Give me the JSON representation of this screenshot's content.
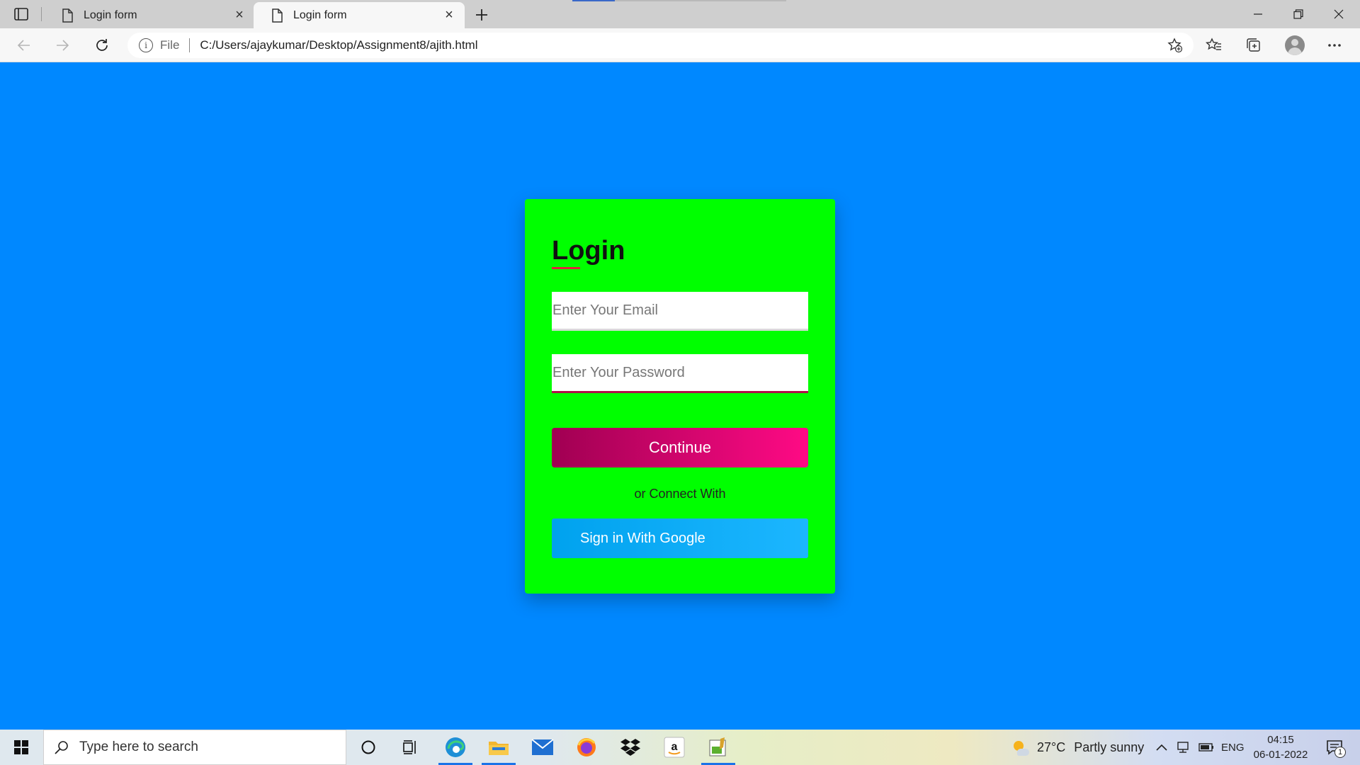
{
  "browser": {
    "tabs": [
      {
        "title": "Login form",
        "active": false
      },
      {
        "title": "Login form",
        "active": true
      }
    ],
    "address": {
      "scheme_label": "File",
      "url": "C:/Users/ajaykumar/Desktop/Assignment8/ajith.html"
    }
  },
  "page": {
    "background": "#0088ff",
    "card_color": "#00ff00",
    "title": "Login",
    "email_placeholder": "Enter Your Email",
    "password_placeholder": "Enter Your Password",
    "continue_label": "Continue",
    "connect_text": "or Connect With",
    "google_label": "Sign in With Google"
  },
  "taskbar": {
    "search_placeholder": "Type here to search",
    "weather": {
      "temp": "27°C",
      "condition": "Partly sunny"
    },
    "language": "ENG",
    "time": "04:15",
    "date": "06-01-2022",
    "notification_count": "1"
  }
}
